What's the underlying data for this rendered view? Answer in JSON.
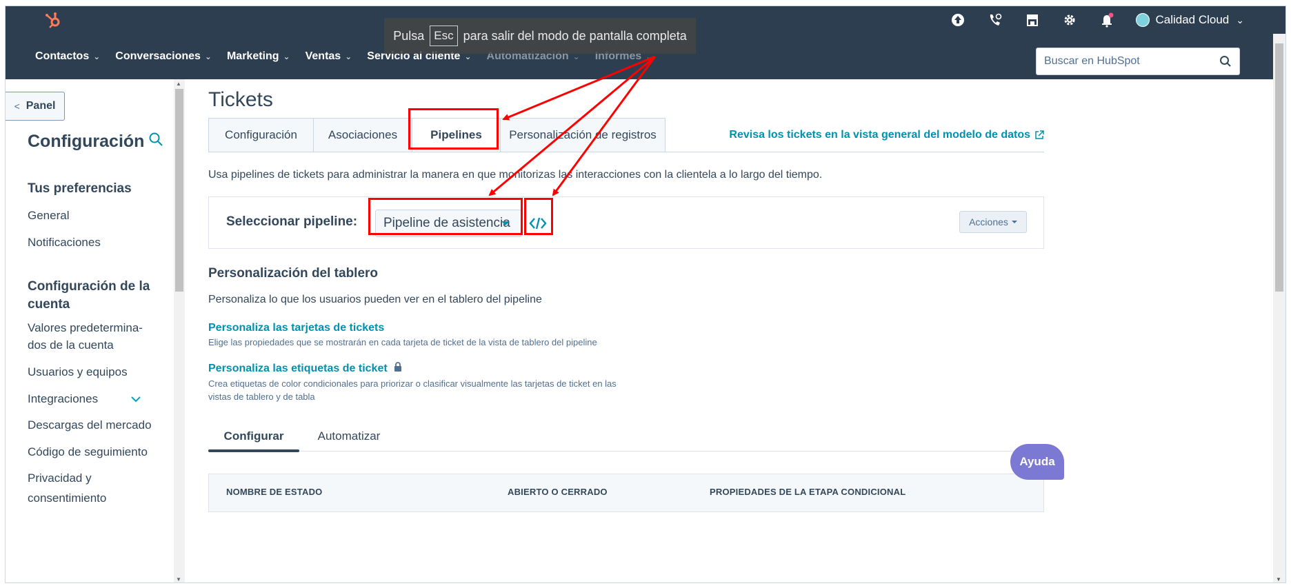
{
  "fullscreen_toast": {
    "prefix": "Pulsa",
    "key": "Esc",
    "suffix": "para salir del modo de pantalla completa"
  },
  "topbar": {
    "icons": [
      "upgrade-icon",
      "calling-icon",
      "marketplace-icon",
      "settings-icon",
      "notifications-icon"
    ],
    "account_name": "Calidad Cloud"
  },
  "nav": {
    "items": [
      {
        "label": "Contactos"
      },
      {
        "label": "Conversaciones"
      },
      {
        "label": "Marketing"
      },
      {
        "label": "Ventas"
      },
      {
        "label": "Servicio al cliente"
      },
      {
        "label": "Automatización"
      },
      {
        "label": "Informes"
      }
    ],
    "search_placeholder": "Buscar en HubSpot"
  },
  "sidebar": {
    "panel_label": "Panel",
    "title": "Configuración",
    "prefs_heading": "Tus preferencias",
    "prefs_items": [
      "General",
      "Notificaciones"
    ],
    "account_heading": "Configuración de la cuenta",
    "account_items": [
      "Valores predetermina-dos de la cuenta",
      "Usuarios y equipos",
      "Integraciones",
      "Descargas del mercado",
      "Código de seguimiento",
      "Privacidad y consentimiento"
    ]
  },
  "content": {
    "title": "Tickets",
    "tabs": [
      "Configuración",
      "Asociaciones",
      "Pipelines",
      "Personalización de registros"
    ],
    "active_tab": "Pipelines",
    "datamodel_link": "Revisa los tickets en la vista general del modelo de datos",
    "intro": "Usa pipelines de tickets para administrar la manera en que monitorizas las interacciones con la clientela a lo largo del tiempo.",
    "pipeline_label": "Seleccionar pipeline:",
    "pipeline_value": "Pipeline de asistencia",
    "actions_label": "Acciones",
    "board_heading": "Personalización del tablero",
    "board_desc": "Personaliza lo que los usuarios pueden ver en el tablero del pipeline",
    "card_link": "Personaliza las tarjetas de tickets",
    "card_desc": "Elige las propiedades que se mostrarán en cada tarjeta de ticket de la vista de tablero del pipeline",
    "tag_link": "Personaliza las etiquetas de ticket",
    "tag_desc": "Crea etiquetas de color condicionales para priorizar o clasificar visualmente las tarjetas de ticket en las vistas de tablero y de tabla",
    "subtabs": [
      "Configurar",
      "Automatizar"
    ],
    "table_headers": [
      "NOMBRE DE ESTADO",
      "ABIERTO O CERRADO",
      "PROPIEDADES DE LA ETAPA CONDICIONAL"
    ]
  },
  "help_label": "Ayuda",
  "colors": {
    "nav_bg": "#2d3e50",
    "link": "#0091ae",
    "annotation": "#ff0000",
    "help": "#7b79d3"
  }
}
